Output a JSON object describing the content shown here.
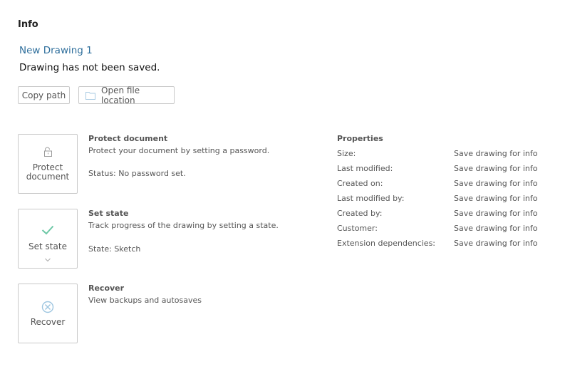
{
  "header": {
    "title": "Info"
  },
  "document": {
    "name": "New Drawing 1",
    "status": "Drawing has not been saved."
  },
  "buttons": {
    "copy_path": "Copy path",
    "open_location": "Open file location"
  },
  "protect": {
    "card_line1": "Protect",
    "card_line2": "document",
    "title": "Protect document",
    "description": "Protect your document by setting a password.",
    "status": "Status: No password set."
  },
  "state": {
    "card_label": "Set state",
    "title": "Set state",
    "description": "Track progress of the drawing by setting a state.",
    "status": "State: Sketch"
  },
  "recover": {
    "card_label": "Recover",
    "title": "Recover",
    "description": "View backups and autosaves"
  },
  "properties": {
    "title": "Properties",
    "rows": [
      {
        "key": "Size:",
        "value": "Save drawing for info"
      },
      {
        "key": "Last modified:",
        "value": "Save drawing for info"
      },
      {
        "key": "Created on:",
        "value": "Save drawing for info"
      },
      {
        "key": "Last modified by:",
        "value": "Save drawing for info"
      },
      {
        "key": "Created by:",
        "value": "Save drawing for info"
      },
      {
        "key": "Customer:",
        "value": "Save drawing for info"
      },
      {
        "key": "Extension dependencies:",
        "value": "Save drawing for info"
      }
    ]
  },
  "colors": {
    "link": "#2f6f9c",
    "accent_check": "#6cc7a5",
    "icon_blue": "#9ec6e0"
  },
  "icons": {
    "open_location": "folder-icon",
    "protect": "lock-icon",
    "state": "checkmark-icon",
    "state_dropdown": "chevron-down-icon",
    "recover": "recover-circle-x-icon"
  }
}
